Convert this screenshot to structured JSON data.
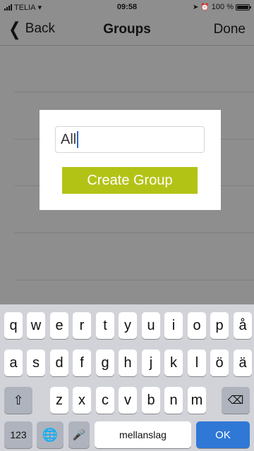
{
  "status": {
    "carrier": "TELIA",
    "time": "09:58",
    "battery": "100 %"
  },
  "nav": {
    "back": "Back",
    "title": "Groups",
    "done": "Done"
  },
  "dialog": {
    "input_value": "All",
    "button": "Create Group"
  },
  "keyboard": {
    "row1": [
      "q",
      "w",
      "e",
      "r",
      "t",
      "y",
      "u",
      "i",
      "o",
      "p",
      "å"
    ],
    "row2": [
      "a",
      "s",
      "d",
      "f",
      "g",
      "h",
      "j",
      "k",
      "l",
      "ö",
      "ä"
    ],
    "row3": [
      "z",
      "x",
      "c",
      "v",
      "b",
      "n",
      "m"
    ],
    "numbers": "123",
    "space": "mellanslag",
    "ok": "OK"
  },
  "colors": {
    "accent": "#b3c316",
    "ok_key": "#2f78d6",
    "overlay": "#8e8e8e"
  }
}
